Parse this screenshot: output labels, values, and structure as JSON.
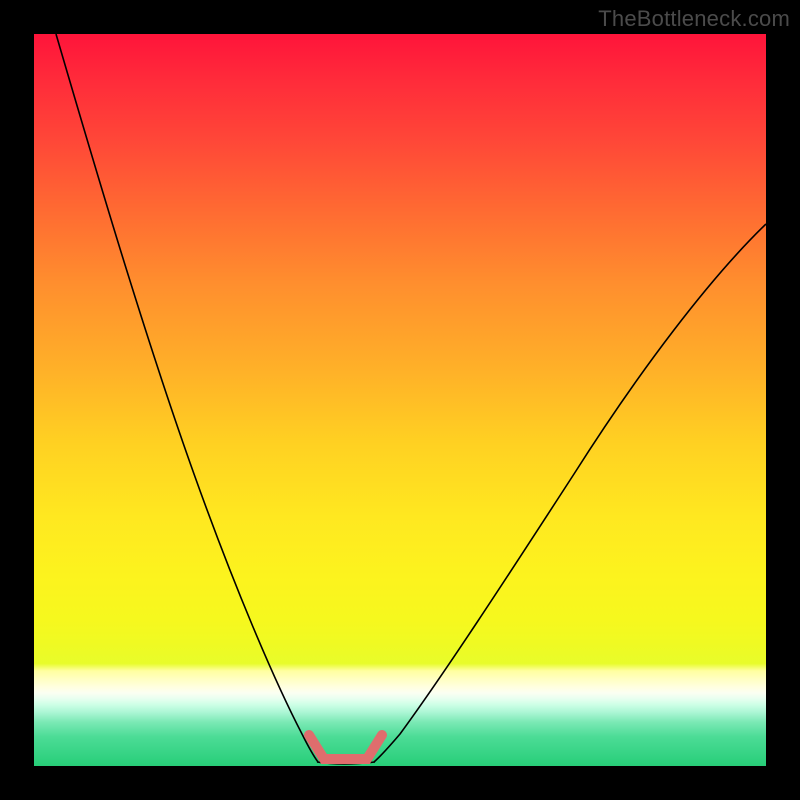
{
  "watermark": "TheBottleneck.com",
  "colors": {
    "background": "#000000",
    "curve": "#000000",
    "highlight": "#df6d6d"
  },
  "chart_data": {
    "type": "line",
    "title": "",
    "xlabel": "",
    "ylabel": "",
    "xlim": [
      0,
      100
    ],
    "ylim": [
      0,
      100
    ],
    "grid": false,
    "legend": false,
    "annotations": [],
    "series": [
      {
        "name": "left-branch",
        "x": [
          3,
          8,
          14,
          20,
          26,
          32,
          36,
          38.7
        ],
        "values": [
          100,
          80,
          60,
          41,
          24,
          10,
          3,
          0.5
        ]
      },
      {
        "name": "right-branch",
        "x": [
          46.5,
          50,
          56,
          63,
          71,
          80,
          90,
          100
        ],
        "values": [
          0.5,
          2,
          8,
          18,
          31,
          45,
          60,
          74
        ]
      },
      {
        "name": "floor",
        "x": [
          38.7,
          42,
          46.5
        ],
        "values": [
          0.5,
          0,
          0.5
        ]
      }
    ],
    "highlight": {
      "description": "pink segment near minimum of V-curve",
      "points": [
        {
          "x": 37.5,
          "y": 4
        },
        {
          "x": 39.5,
          "y": 0.5
        },
        {
          "x": 45.5,
          "y": 0.5
        },
        {
          "x": 47.5,
          "y": 4
        }
      ]
    }
  }
}
